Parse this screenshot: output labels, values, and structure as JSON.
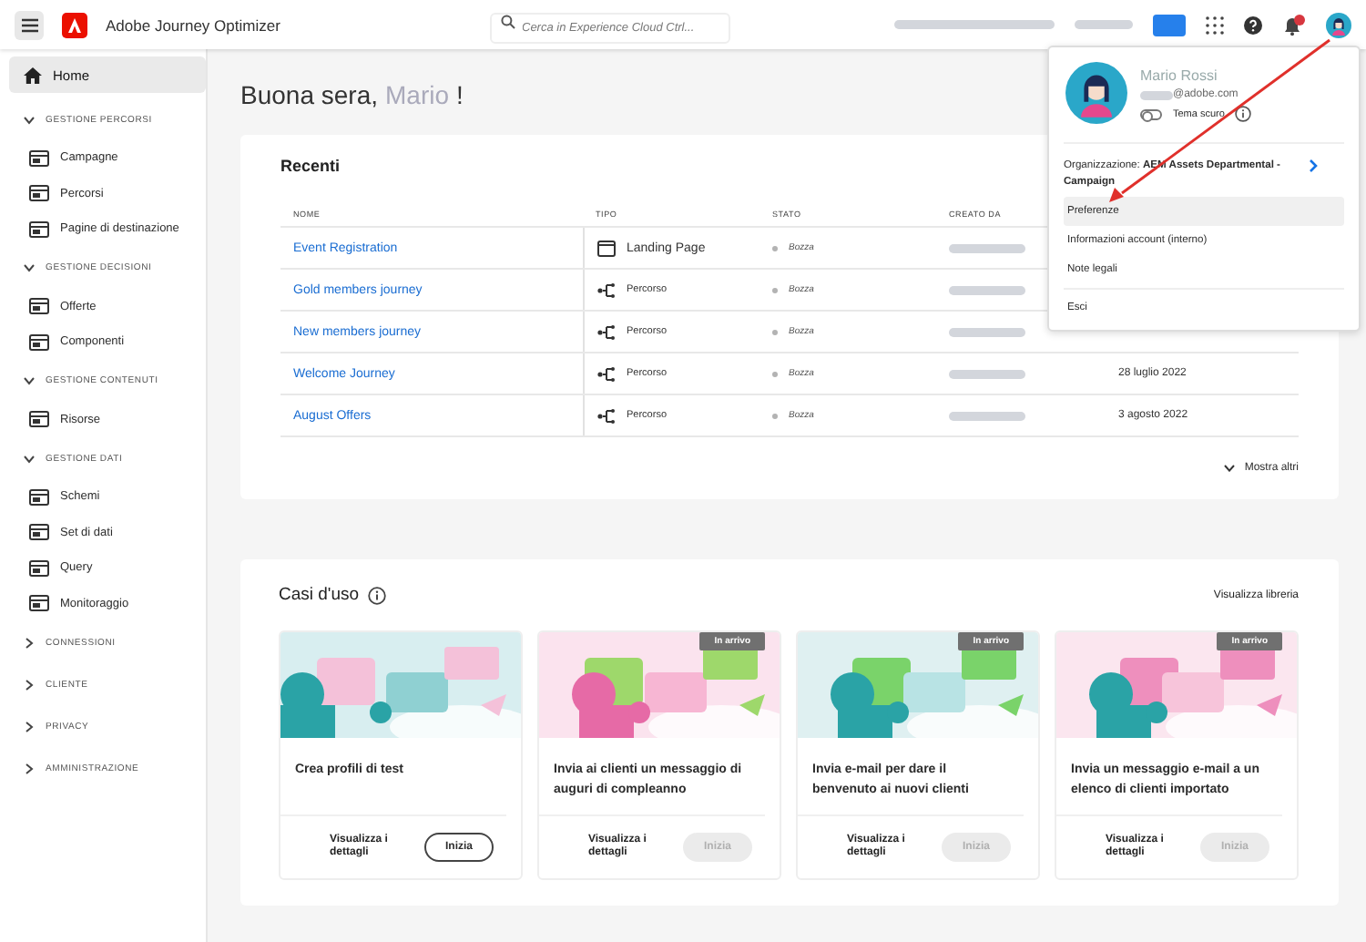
{
  "header": {
    "app_title": "Adobe Journey Optimizer",
    "search": {
      "placeholder": "Cerca in Experience Cloud Ctrl..."
    }
  },
  "sidebar": {
    "items": [
      {
        "kind": "item",
        "label": "Home",
        "selected": true
      },
      {
        "kind": "section",
        "label": "GESTIONE PERCORSI",
        "expanded": true,
        "children": [
          {
            "label": "Campagne",
            "selected": false
          },
          {
            "label": "Percorsi",
            "selected": false
          },
          {
            "label": "Pagine di destinazione",
            "selected": false
          }
        ]
      },
      {
        "kind": "section",
        "label": "GESTIONE DECISIONI",
        "expanded": true,
        "children": [
          {
            "label": "Offerte",
            "selected": false
          },
          {
            "label": "Componenti",
            "selected": false
          }
        ]
      },
      {
        "kind": "section",
        "label": "GESTIONE CONTENUTI",
        "expanded": true,
        "children": [
          {
            "label": "Risorse",
            "selected": false
          }
        ]
      },
      {
        "kind": "section",
        "label": "GESTIONE DATI",
        "expanded": true,
        "children": [
          {
            "label": "Schemi",
            "selected": false
          },
          {
            "label": "Set di dati",
            "selected": false
          },
          {
            "label": "Query",
            "selected": false
          },
          {
            "label": "Monitoraggio",
            "selected": false
          }
        ]
      },
      {
        "kind": "section",
        "label": "CONNESSIONI",
        "expanded": false
      },
      {
        "kind": "section",
        "label": "CLIENTE",
        "expanded": false
      },
      {
        "kind": "section",
        "label": "PRIVACY",
        "expanded": false
      },
      {
        "kind": "section",
        "label": "AMMINISTRAZIONE",
        "expanded": false
      }
    ]
  },
  "greeting": {
    "text": "Buona sera,",
    "name": "Mario",
    "end": "!"
  },
  "recent": {
    "title": "Recenti",
    "columns": [
      "NOME",
      "TIPO",
      "STATO",
      "CREATO DA"
    ],
    "rows": [
      {
        "name": "Event Registration",
        "type": {
          "kind": "landing",
          "label": "Landing Page"
        },
        "status": "Bozza"
      },
      {
        "name": "Gold members journey",
        "type": {
          "kind": "journey",
          "label": "Percorso"
        },
        "status": "Bozza"
      },
      {
        "name": "New members journey",
        "type": {
          "kind": "journey",
          "label": "Percorso"
        },
        "status": "Bozza"
      },
      {
        "name": "Welcome Journey",
        "type": {
          "kind": "journey",
          "label": "Percorso"
        },
        "status": "Bozza",
        "date": "28 luglio 2022"
      },
      {
        "name": "August Offers",
        "type": {
          "kind": "journey",
          "label": "Percorso"
        },
        "status": "Bozza",
        "date": "3 agosto 2022"
      }
    ],
    "show_more": "Mostra altri"
  },
  "use_cases": {
    "title": "Casi d'uso",
    "library_link": "Visualizza libreria",
    "cards": [
      {
        "title": "Crea profili di test",
        "details": "Visualizza i dettagli",
        "start": "Inizia",
        "disabled": false
      },
      {
        "title": "Invia ai clienti un messaggio di auguri di compleanno",
        "badge": "In arrivo",
        "details": "Visualizza i dettagli",
        "start": "Inizia",
        "disabled": true
      },
      {
        "title": "Invia e-mail per dare il benvenuto ai nuovi clienti",
        "badge": "In arrivo",
        "details": "Visualizza i dettagli",
        "start": "Inizia",
        "disabled": true
      },
      {
        "title": "Invia un messaggio e-mail a un elenco di clienti importato",
        "badge": "In arrivo",
        "details": "Visualizza i dettagli",
        "start": "Inizia",
        "disabled": true
      }
    ]
  },
  "profile_menu": {
    "name": "Mario Rossi",
    "email": "@adobe.com",
    "dark_theme": {
      "label": "Tema scuro",
      "on": false
    },
    "organization_label": "Organizzazione:",
    "organization": "AEM Assets Departmental - Campaign",
    "items": [
      {
        "label": "Preferenze",
        "selected": true
      },
      {
        "label": "Informazioni account (interno)",
        "selected": false
      },
      {
        "label": "Note legali",
        "selected": false
      }
    ],
    "sign_out": "Esci"
  }
}
